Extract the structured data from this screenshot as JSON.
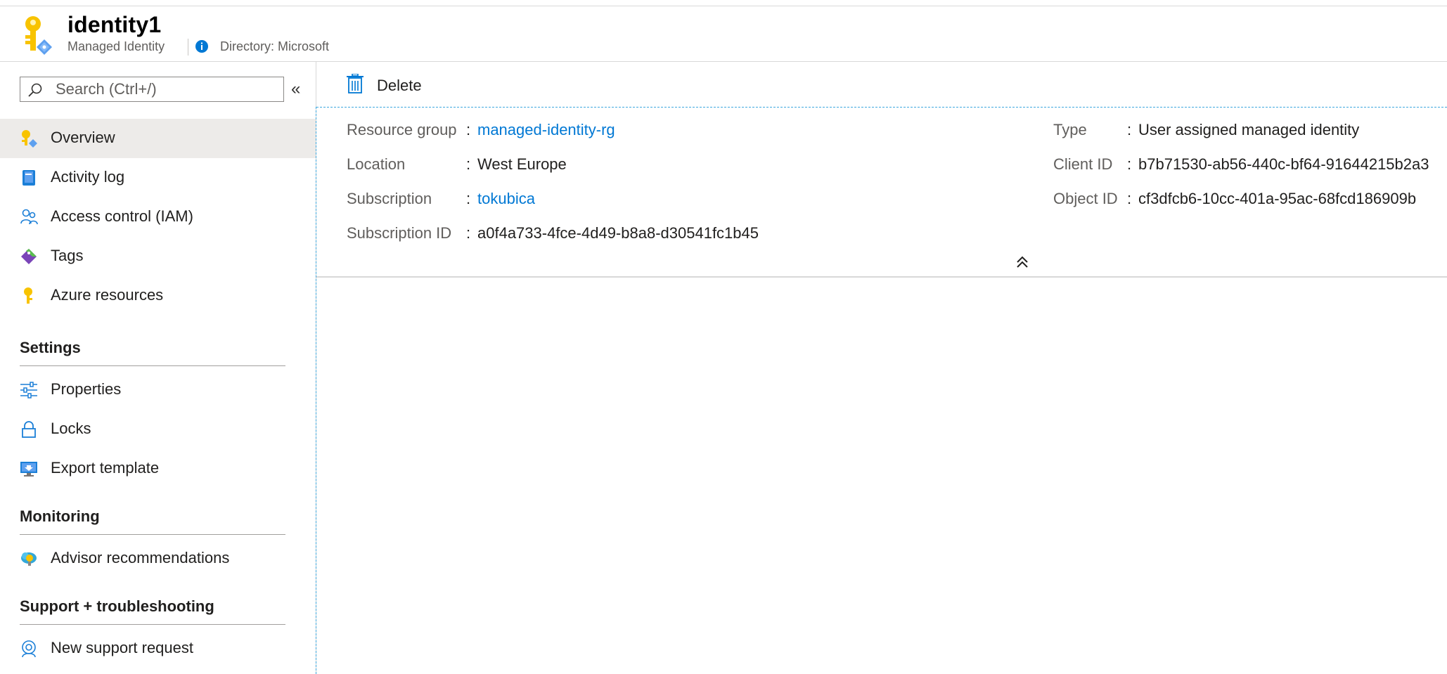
{
  "header": {
    "title": "identity1",
    "subtitle": "Managed Identity",
    "directory": "Directory: Microsoft"
  },
  "search": {
    "placeholder": "Search (Ctrl+/)"
  },
  "nav": {
    "items": [
      {
        "label": "Overview",
        "icon": "key-overview-icon",
        "active": true
      },
      {
        "label": "Activity log",
        "icon": "activity-log-icon"
      },
      {
        "label": "Access control (IAM)",
        "icon": "users-iam-icon"
      },
      {
        "label": "Tags",
        "icon": "tag-icon"
      },
      {
        "label": "Azure resources",
        "icon": "key-icon"
      }
    ],
    "sections": [
      {
        "title": "Settings",
        "items": [
          {
            "label": "Properties",
            "icon": "sliders-icon"
          },
          {
            "label": "Locks",
            "icon": "lock-icon"
          },
          {
            "label": "Export template",
            "icon": "export-template-icon"
          }
        ]
      },
      {
        "title": "Monitoring",
        "items": [
          {
            "label": "Advisor recommendations",
            "icon": "advisor-icon"
          }
        ]
      },
      {
        "title": "Support + troubleshooting",
        "items": [
          {
            "label": "New support request",
            "icon": "support-icon"
          }
        ]
      }
    ]
  },
  "toolbar": {
    "delete_label": "Delete"
  },
  "essentials": {
    "left": [
      {
        "key": "Resource group",
        "value": "managed-identity-rg",
        "link": true
      },
      {
        "key": "Location",
        "value": "West Europe",
        "link": false
      },
      {
        "key": "Subscription",
        "value": "tokubica",
        "link": true
      },
      {
        "key": "Subscription ID",
        "value": "a0f4a733-4fce-4d49-b8a8-d30541fc1b45",
        "link": false
      }
    ],
    "right": [
      {
        "key": "Type",
        "value": "User assigned managed identity"
      },
      {
        "key": "Client ID",
        "value": "b7b71530-ab56-440c-bf64-91644215b2a3"
      },
      {
        "key": "Object ID",
        "value": "cf3dfcb6-10cc-401a-95ac-68fcd186909b"
      }
    ],
    "separator": ":"
  },
  "colors": {
    "accent": "#0078d4",
    "link": "#0078d4",
    "key_yellow": "#f8c300",
    "active_bg": "#edebe9",
    "dashed_focus": "#3da7de"
  }
}
